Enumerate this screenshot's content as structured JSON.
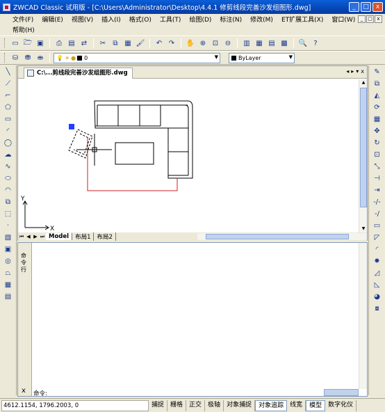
{
  "window": {
    "title": "ZWCAD Classic 试用版 - [C:\\Users\\Administrator\\Desktop\\4.4.1 修剪线段完善沙发组图形.dwg]",
    "min_glyph": "_",
    "max_glyph": "□",
    "close_glyph": "x"
  },
  "menu": {
    "row1": [
      "文件(F)",
      "编辑(E)",
      "视图(V)",
      "插入(I)",
      "格式(O)",
      "工具(T)",
      "绘图(D)",
      "标注(N)",
      "修改(M)",
      "ET扩展工具(X)",
      "窗口(W)"
    ],
    "row2": [
      "帮助(H)"
    ],
    "mdi_buttons": [
      "_",
      "□",
      "x"
    ]
  },
  "toolbar2": {
    "layer_value": "0",
    "color_value": "ByLayer",
    "color_swatch": "#000000"
  },
  "document": {
    "tab_label": "C:\\...剪线段完善沙发组图形.dwg",
    "nav_glyphs": [
      "◂",
      "▸",
      "▾",
      "x"
    ]
  },
  "canvas": {
    "axis_x": "X",
    "axis_y": "Y",
    "grip_color": "#1f3fff",
    "trim_color": "#cc2222"
  },
  "layout_tabs": {
    "tabs": [
      "Model",
      "布局1",
      "布局2"
    ],
    "active": "Model"
  },
  "command": {
    "side_label": "命令行",
    "prompt": "命令:",
    "close_glyph": "x"
  },
  "status": {
    "coords": "4612.1154,  1796.2003,  0",
    "buttons": [
      "捕捉",
      "栅格",
      "正交",
      "极轴",
      "对象捕捉",
      "对象追踪",
      "线宽",
      "模型",
      "数字化仪"
    ],
    "pressed": [
      "对象追踪",
      "模型"
    ]
  }
}
